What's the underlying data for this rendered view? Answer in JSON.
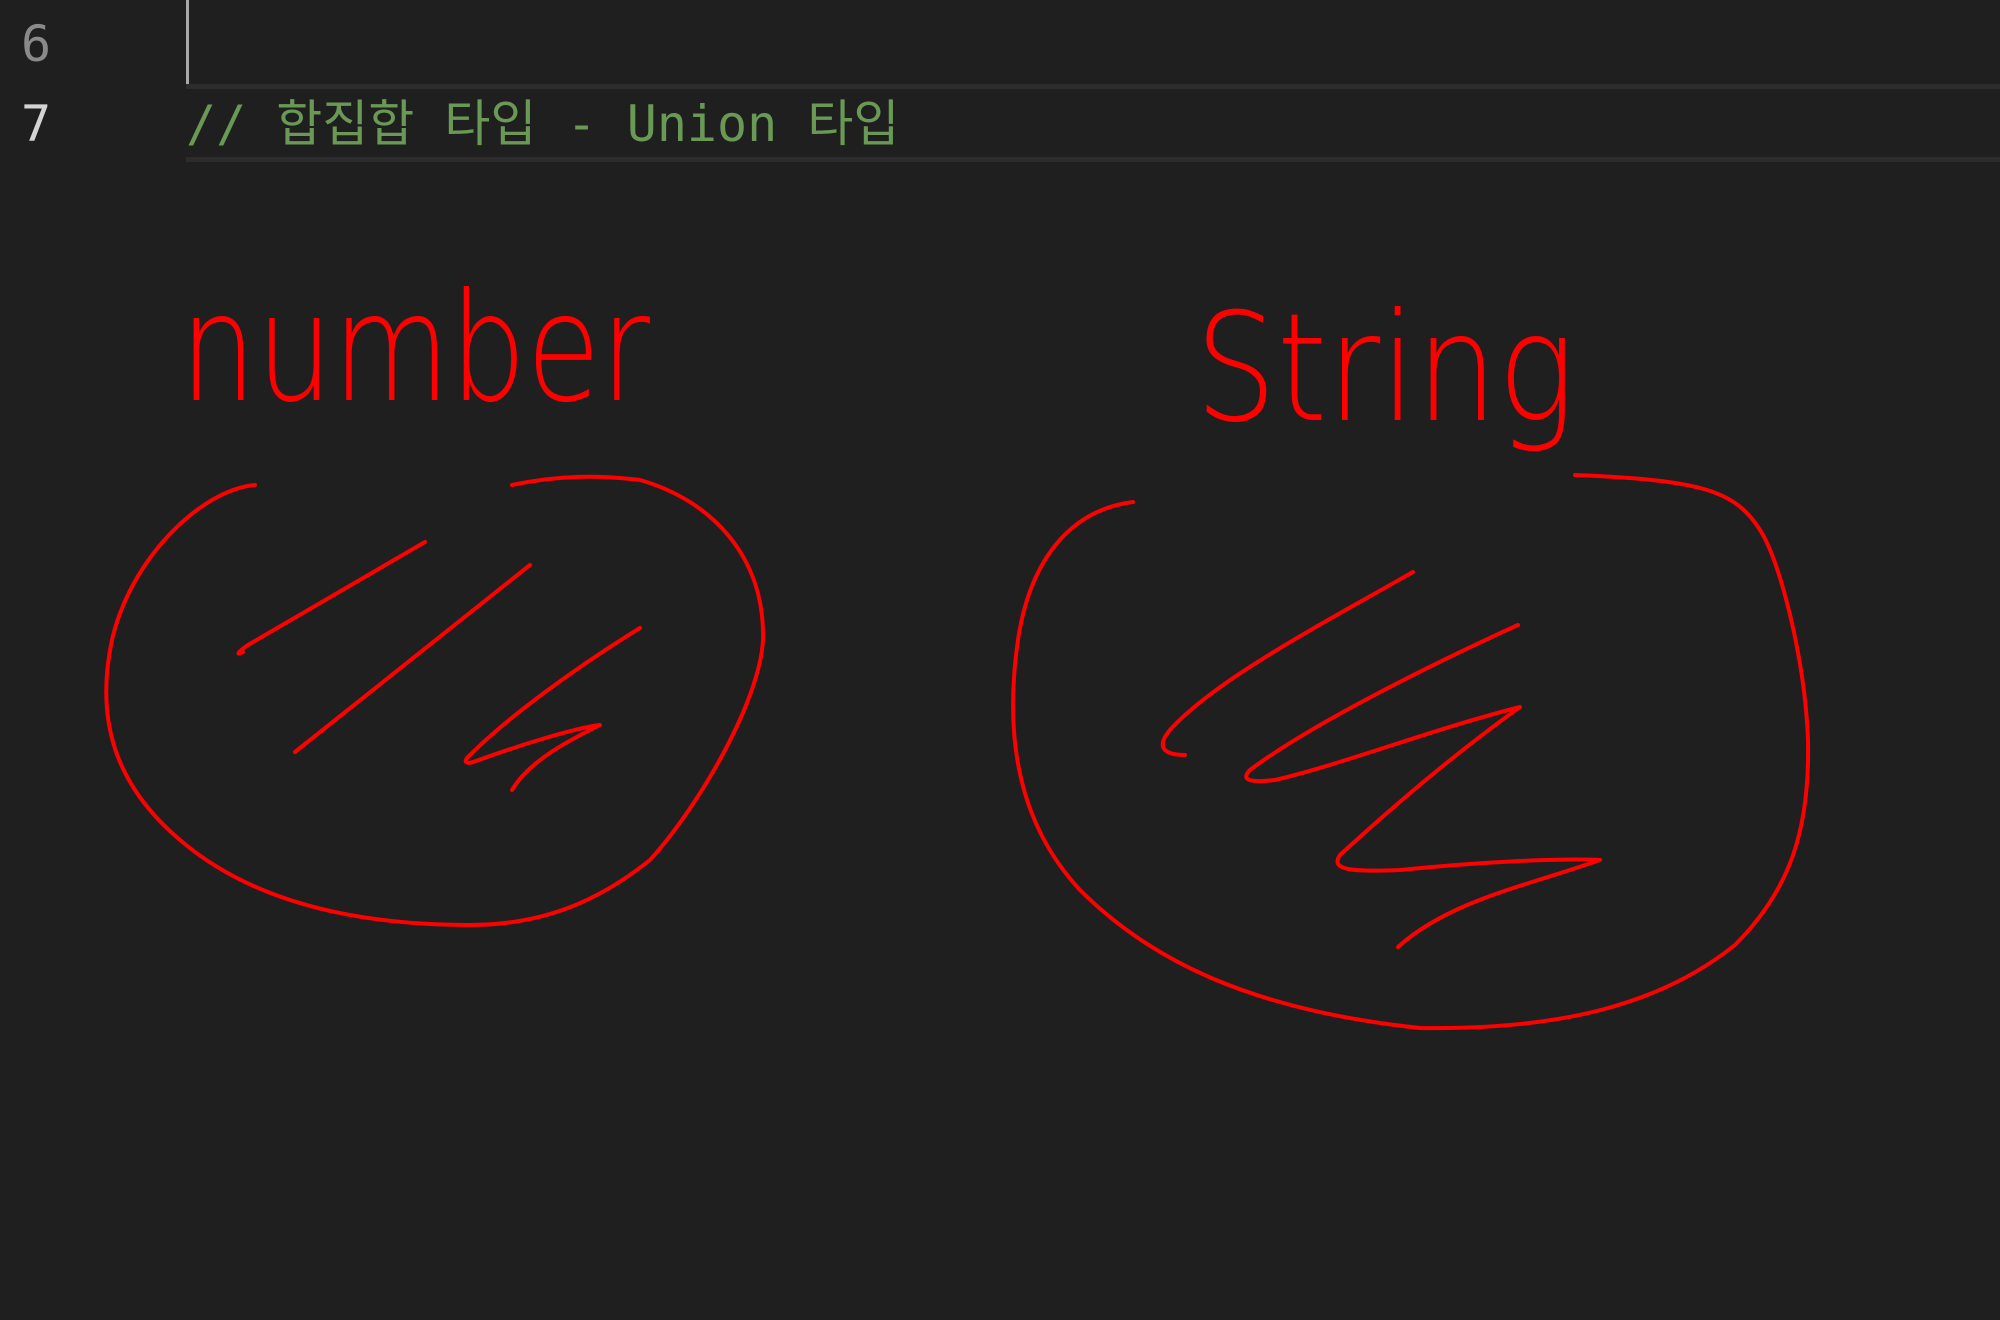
{
  "editor": {
    "lines": [
      {
        "number": "6",
        "code": ""
      },
      {
        "number": "7",
        "code": "// 합집합 타입 - Union 타입"
      }
    ]
  },
  "annotations": {
    "left_label": "number",
    "right_label": "String",
    "ink_color": "#ff0000"
  },
  "colors": {
    "background": "#1f1f1f",
    "comment": "#6a9955",
    "line_number_active": "#d4d4d4",
    "line_number_inactive": "#8a8a8a"
  }
}
